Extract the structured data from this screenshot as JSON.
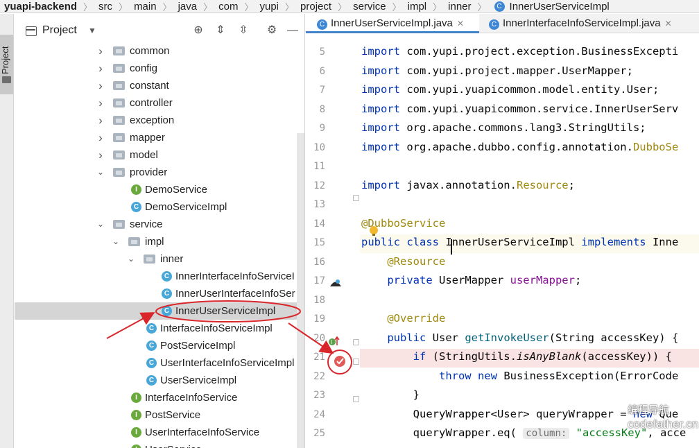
{
  "breadcrumb": [
    "yuapi-backend",
    "src",
    "main",
    "java",
    "com",
    "yupi",
    "project",
    "service",
    "impl",
    "inner",
    "InnerUserServiceImpl"
  ],
  "side_strip": {
    "label": "Project"
  },
  "project_panel": {
    "title": "Project",
    "tree": [
      {
        "label": "common",
        "type": "folder",
        "depth": 0,
        "state": "collapsed"
      },
      {
        "label": "config",
        "type": "folder",
        "depth": 0,
        "state": "collapsed"
      },
      {
        "label": "constant",
        "type": "folder",
        "depth": 0,
        "state": "collapsed"
      },
      {
        "label": "controller",
        "type": "folder",
        "depth": 0,
        "state": "collapsed"
      },
      {
        "label": "exception",
        "type": "folder",
        "depth": 0,
        "state": "collapsed"
      },
      {
        "label": "mapper",
        "type": "folder",
        "depth": 0,
        "state": "collapsed"
      },
      {
        "label": "model",
        "type": "folder",
        "depth": 0,
        "state": "collapsed"
      },
      {
        "label": "provider",
        "type": "folder",
        "depth": 0,
        "state": "expanded"
      },
      {
        "label": "DemoService",
        "type": "interface",
        "depth": 1
      },
      {
        "label": "DemoServiceImpl",
        "type": "class",
        "depth": 1
      },
      {
        "label": "service",
        "type": "folder",
        "depth": 0,
        "state": "expanded"
      },
      {
        "label": "impl",
        "type": "folder",
        "depth": 1,
        "state": "expanded"
      },
      {
        "label": "inner",
        "type": "folder",
        "depth": 2,
        "state": "expanded"
      },
      {
        "label": "InnerInterfaceInfoServiceI",
        "type": "class",
        "depth": 3
      },
      {
        "label": "InnerUserInterfaceInfoSer",
        "type": "class",
        "depth": 3
      },
      {
        "label": "InnerUserServiceImpl",
        "type": "class",
        "depth": 3,
        "selected": true
      },
      {
        "label": "InterfaceInfoServiceImpl",
        "type": "class",
        "depth": 2
      },
      {
        "label": "PostServiceImpl",
        "type": "class",
        "depth": 2
      },
      {
        "label": "UserInterfaceInfoServiceImpl",
        "type": "class",
        "depth": 2
      },
      {
        "label": "UserServiceImpl",
        "type": "class",
        "depth": 2
      },
      {
        "label": "InterfaceInfoService",
        "type": "interface",
        "depth": 1
      },
      {
        "label": "PostService",
        "type": "interface",
        "depth": 1
      },
      {
        "label": "UserInterfaceInfoService",
        "type": "interface",
        "depth": 1
      },
      {
        "label": "UserService",
        "type": "interface",
        "depth": 1
      }
    ]
  },
  "tabs": [
    {
      "label": "InnerUserServiceImpl.java",
      "active": true
    },
    {
      "label": "InnerInterfaceInfoServiceImpl.java",
      "active": false
    }
  ],
  "editor": {
    "lines": [
      {
        "n": "5",
        "html": "<span class='k'>import</span> com.yupi.project.exception.BusinessExcepti"
      },
      {
        "n": "6",
        "html": "<span class='k'>import</span> com.yupi.project.mapper.UserMapper;"
      },
      {
        "n": "7",
        "html": "<span class='k'>import</span> com.yupi.yuapicommon.model.entity.User;"
      },
      {
        "n": "8",
        "html": "<span class='k'>import</span> com.yupi.yuapicommon.service.InnerUserServ"
      },
      {
        "n": "9",
        "html": "<span class='k'>import</span> org.apache.commons.lang3.StringUtils;"
      },
      {
        "n": "10",
        "html": "<span class='k'>import</span> org.apache.dubbo.config.annotation.<span class='ann'>DubboSe</span>"
      },
      {
        "n": "11",
        "html": ""
      },
      {
        "n": "12",
        "html": "<span class='k'>import</span> javax.annotation.<span class='ann'>Resource</span>;"
      },
      {
        "n": "13",
        "html": ""
      },
      {
        "n": "14",
        "html": "<span class='ann'>@DubboService</span>"
      },
      {
        "n": "15",
        "html": "<span class='k'>public class</span> InnerUserServiceImpl <span class='k'>implements</span> Inne"
      },
      {
        "n": "16",
        "html": "    <span class='ann'>@Resource</span>"
      },
      {
        "n": "17",
        "html": "    <span class='k'>private</span> UserMapper <span class='fld'>userMapper</span>;"
      },
      {
        "n": "18",
        "html": ""
      },
      {
        "n": "19",
        "html": "    <span class='ann'>@Override</span>"
      },
      {
        "n": "20",
        "html": "    <span class='k'>public</span> User <span class='m'>getInvokeUser</span>(String accessKey) {"
      },
      {
        "n": "21",
        "html": "        <span class='k'>if</span> (StringUtils.<span class='it'>isAnyBlank</span>(accessKey)) {"
      },
      {
        "n": "22",
        "html": "            <span class='k'>throw new</span> BusinessException(ErrorCode"
      },
      {
        "n": "23",
        "html": "        }"
      },
      {
        "n": "24",
        "html": "        QueryWrapper&lt;User&gt; queryWrapper = <span class='k'>new</span> Que"
      },
      {
        "n": "25",
        "html": "        queryWrapper.eq( <span class='hint'>column:</span> <span class='str'>\"accessKey\"</span>, acce"
      }
    ]
  },
  "watermark": {
    "line1": "编程导航",
    "line2": "codefather.cn"
  },
  "colors": {
    "annotation_red": "#d9262a",
    "selection": "#d5d5d5",
    "breakpoint_line": "#fae3e3"
  }
}
